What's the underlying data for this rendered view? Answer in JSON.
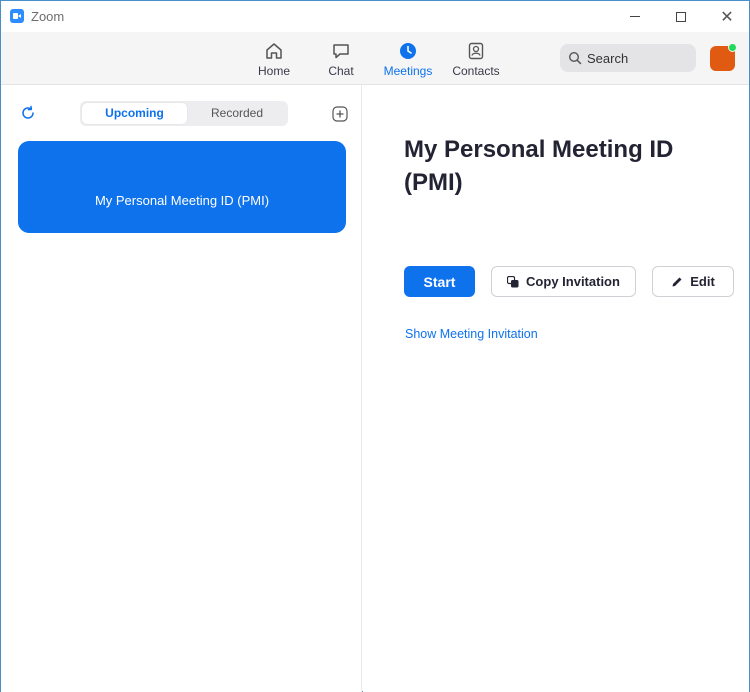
{
  "window": {
    "title": "Zoom",
    "controls": [
      "minimize",
      "maximize",
      "close"
    ]
  },
  "nav": {
    "items": [
      {
        "label": "Home",
        "icon": "home-icon"
      },
      {
        "label": "Chat",
        "icon": "chat-icon"
      },
      {
        "label": "Meetings",
        "icon": "clock-icon",
        "active": true
      },
      {
        "label": "Contacts",
        "icon": "contacts-icon"
      }
    ],
    "search": {
      "label": "Search"
    }
  },
  "left": {
    "tabs": [
      {
        "label": "Upcoming",
        "active": true
      },
      {
        "label": "Recorded"
      }
    ],
    "card": {
      "label": "My Personal Meeting ID (PMI)"
    }
  },
  "right": {
    "title": "My Personal Meeting ID (PMI)",
    "buttons": {
      "start": "Start",
      "copy": "Copy Invitation",
      "edit": "Edit"
    },
    "show_invitation": "Show Meeting Invitation"
  },
  "colors": {
    "accent": "#0e72ed",
    "avatar": "#e05a12",
    "presence": "#23d959"
  }
}
